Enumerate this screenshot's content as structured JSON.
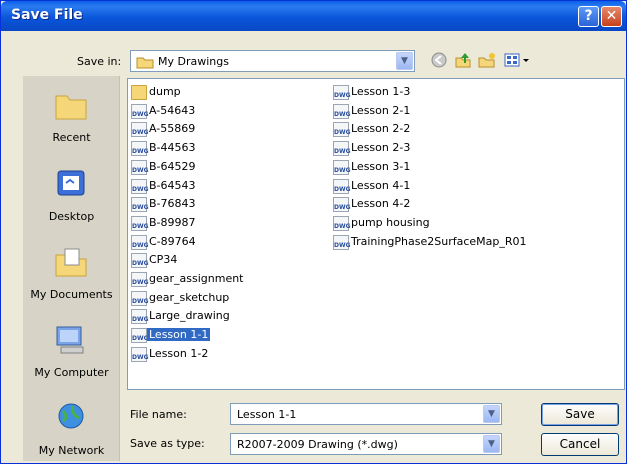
{
  "window": {
    "title": "Save File",
    "help_label": "?",
    "close_label": "✕"
  },
  "toolbar": {
    "savein_label": "Save in:",
    "savein_value": "My Drawings",
    "icons": [
      "back-icon",
      "up-folder-icon",
      "new-folder-icon",
      "views-menu-icon"
    ]
  },
  "places": [
    {
      "label": "Recent",
      "icon": "recent-folder-icon"
    },
    {
      "label": "Desktop",
      "icon": "desktop-icon"
    },
    {
      "label": "My Documents",
      "icon": "my-documents-icon"
    },
    {
      "label": "My Computer",
      "icon": "my-computer-icon"
    },
    {
      "label": "My Network",
      "icon": "my-network-icon"
    }
  ],
  "files": {
    "column1": [
      {
        "name": "dump",
        "type": "folder"
      },
      {
        "name": "A-54643",
        "type": "dwg"
      },
      {
        "name": "A-55869",
        "type": "dwg"
      },
      {
        "name": "B-44563",
        "type": "dwg"
      },
      {
        "name": "B-64529",
        "type": "dwg"
      },
      {
        "name": "B-64543",
        "type": "dwg"
      },
      {
        "name": "B-76843",
        "type": "dwg"
      },
      {
        "name": "B-89987",
        "type": "dwg"
      },
      {
        "name": "C-89764",
        "type": "dwg"
      },
      {
        "name": "CP34",
        "type": "dwg"
      },
      {
        "name": "gear_assignment",
        "type": "dwg"
      },
      {
        "name": "gear_sketchup",
        "type": "dwg"
      },
      {
        "name": "Large_drawing",
        "type": "dwg"
      },
      {
        "name": "Lesson 1-1",
        "type": "dwg",
        "selected": true
      },
      {
        "name": "Lesson 1-2",
        "type": "dwg"
      }
    ],
    "column2": [
      {
        "name": "Lesson 1-3",
        "type": "dwg"
      },
      {
        "name": "Lesson 2-1",
        "type": "dwg"
      },
      {
        "name": "Lesson 2-2",
        "type": "dwg"
      },
      {
        "name": "Lesson 2-3",
        "type": "dwg"
      },
      {
        "name": "Lesson 3-1",
        "type": "dwg"
      },
      {
        "name": "Lesson 4-1",
        "type": "dwg"
      },
      {
        "name": "Lesson 4-2",
        "type": "dwg"
      },
      {
        "name": "pump housing",
        "type": "dwg"
      },
      {
        "name": "TrainingPhase2SurfaceMap_R01",
        "type": "dwg"
      }
    ],
    "dwg_badge": "DWG"
  },
  "form": {
    "filename_label": "File name:",
    "filename_value": "Lesson 1-1",
    "filetype_label": "Save as type:",
    "filetype_value": "R2007-2009 Drawing (*.dwg)"
  },
  "buttons": {
    "save_label": "Save",
    "cancel_label": "Cancel"
  },
  "colors": {
    "title_bar": "#0b56db",
    "selection": "#316ac5",
    "dialog_bg": "#ece9d8"
  }
}
